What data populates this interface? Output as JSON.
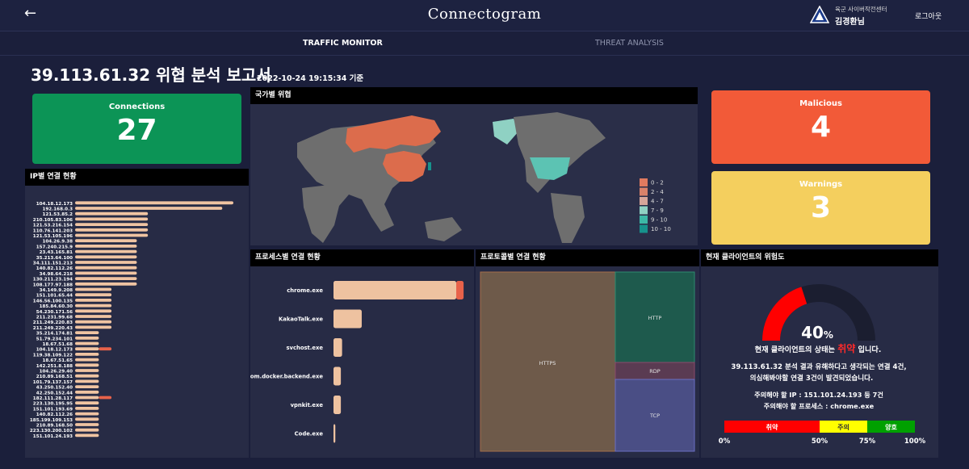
{
  "header": {
    "back_icon": "arrow-left-icon",
    "title": "Connectogram",
    "org": "육군 사이버작전센터",
    "user": "김경환님",
    "logout": "로그아웃"
  },
  "tabs": [
    {
      "label": "TRAFFIC MONITOR",
      "active": true
    },
    {
      "label": "THREAT ANALYSIS",
      "active": false
    }
  ],
  "report": {
    "title": "39.113.61.32 위협 분석 보고서",
    "timestamp": "2022-10-24 19:15:34 기준"
  },
  "connections": {
    "label": "Connections",
    "value": "27",
    "color": "#0c9456"
  },
  "malicious": {
    "label": "Malicious",
    "value": "4",
    "color": "#f25a38"
  },
  "warnings": {
    "label": "Warnings",
    "value": "3",
    "color": "#f4cf5e"
  },
  "ip_panel": {
    "title": "IP별 연결 현황",
    "rows": [
      {
        "ip": "104.18.12.173",
        "v": 100,
        "mal": 0
      },
      {
        "ip": "192.168.0.3",
        "v": 93,
        "mal": 0
      },
      {
        "ip": "121.53.85.2",
        "v": 46,
        "mal": 0
      },
      {
        "ip": "210.105.83.106",
        "v": 46,
        "mal": 0
      },
      {
        "ip": "121.53.216.154",
        "v": 46,
        "mal": 0
      },
      {
        "ip": "110.76.141.203",
        "v": 46,
        "mal": 0
      },
      {
        "ip": "121.53.105.196",
        "v": 46,
        "mal": 0
      },
      {
        "ip": "104.26.9.38",
        "v": 39,
        "mal": 0
      },
      {
        "ip": "157.240.215.9",
        "v": 39,
        "mal": 0
      },
      {
        "ip": "23.43.165.81",
        "v": 39,
        "mal": 0
      },
      {
        "ip": "35.213.64.100",
        "v": 39,
        "mal": 0
      },
      {
        "ip": "34.111.151.213",
        "v": 39,
        "mal": 0
      },
      {
        "ip": "140.82.112.26",
        "v": 39,
        "mal": 0
      },
      {
        "ip": "34.98.64.218",
        "v": 39,
        "mal": 0
      },
      {
        "ip": "130.211.23.194",
        "v": 39,
        "mal": 0
      },
      {
        "ip": "108.177.97.188",
        "v": 39,
        "mal": 0
      },
      {
        "ip": "34.149.9.208",
        "v": 23,
        "mal": 0
      },
      {
        "ip": "151.101.65.44",
        "v": 23,
        "mal": 0
      },
      {
        "ip": "146.56.100.135",
        "v": 23,
        "mal": 0
      },
      {
        "ip": "185.84.60.30",
        "v": 23,
        "mal": 0
      },
      {
        "ip": "54.230.171.56",
        "v": 23,
        "mal": 0
      },
      {
        "ip": "211.231.99.68",
        "v": 23,
        "mal": 0
      },
      {
        "ip": "211.249.220.83",
        "v": 23,
        "mal": 0
      },
      {
        "ip": "211.249.220.43",
        "v": 23,
        "mal": 0
      },
      {
        "ip": "35.214.174.81",
        "v": 15,
        "mal": 0
      },
      {
        "ip": "51.79.234.101",
        "v": 15,
        "mal": 0
      },
      {
        "ip": "18.67.51.68",
        "v": 15,
        "mal": 0
      },
      {
        "ip": "104.18.12.173",
        "v": 15,
        "mal": 8
      },
      {
        "ip": "119.38.109.122",
        "v": 15,
        "mal": 0
      },
      {
        "ip": "18.67.51.65",
        "v": 15,
        "mal": 0
      },
      {
        "ip": "142.251.8.188",
        "v": 15,
        "mal": 0
      },
      {
        "ip": "104.26.29.40",
        "v": 15,
        "mal": 0
      },
      {
        "ip": "210.89.168.51",
        "v": 15,
        "mal": 0
      },
      {
        "ip": "101.79.137.157",
        "v": 15,
        "mal": 0
      },
      {
        "ip": "43.250.152.40",
        "v": 15,
        "mal": 0
      },
      {
        "ip": "42.250.152.44",
        "v": 15,
        "mal": 0
      },
      {
        "ip": "182.111.28.117",
        "v": 15,
        "mal": 8
      },
      {
        "ip": "223.130.195.95",
        "v": 15,
        "mal": 0
      },
      {
        "ip": "151.101.193.69",
        "v": 15,
        "mal": 0
      },
      {
        "ip": "140.82.112.26",
        "v": 15,
        "mal": 0
      },
      {
        "ip": "185.199.109.153",
        "v": 15,
        "mal": 0
      },
      {
        "ip": "210.89.168.50",
        "v": 15,
        "mal": 0
      },
      {
        "ip": "223.130.200.102",
        "v": 15,
        "mal": 0
      },
      {
        "ip": "151.101.24.193",
        "v": 15,
        "mal": 0
      }
    ]
  },
  "map_panel": {
    "title": "국가별 위협",
    "legend": [
      {
        "label": "0 - 2",
        "color": "#e07a5f"
      },
      {
        "label": "2 - 4",
        "color": "#d9826a"
      },
      {
        "label": "4 - 7",
        "color": "#d7a69a"
      },
      {
        "label": "7 - 9",
        "color": "#8fd1c3"
      },
      {
        "label": "9 - 10",
        "color": "#3cb8a6"
      },
      {
        "label": "10 - 10",
        "color": "#17928c"
      }
    ]
  },
  "process_panel": {
    "title": "프로세스별 연결 현황",
    "rows": [
      {
        "name": "chrome.exe",
        "v": 100,
        "mal": 6
      },
      {
        "name": "KakaoTalk.exe",
        "v": 23,
        "mal": 0
      },
      {
        "name": "svchost.exe",
        "v": 7,
        "mal": 0
      },
      {
        "name": "com.docker.backend.exe",
        "v": 6,
        "mal": 0
      },
      {
        "name": "vpnkit.exe",
        "v": 6,
        "mal": 0
      },
      {
        "name": "Code.exe",
        "v": 1.5,
        "mal": 0
      }
    ]
  },
  "protocol_panel": {
    "title": "프로토콜별 연결 현황",
    "cells": [
      {
        "label": "HTTPS",
        "color": "#6e5a4a",
        "border": "#a46d4a"
      },
      {
        "label": "HTTP",
        "color": "#1e5a4d",
        "border": "#2f8b6e"
      },
      {
        "label": "RDP",
        "color": "#5a3b52",
        "border": "#8b4a6b"
      },
      {
        "label": "TCP",
        "color": "#4a4e85",
        "border": "#6a6fc2"
      }
    ]
  },
  "risk_panel": {
    "title": "현재 클라이언트의 위험도",
    "gauge_value": 40,
    "gauge_text": "40",
    "gauge_unit": "%",
    "status_prefix": "현재 클라이언트의 상태는 ",
    "status_word": "취약",
    "status_suffix": " 입니다.",
    "line1": "39.113.61.32 분석 결과 유해하다고 생각되는 연결 4건,",
    "line2": "의심해봐야할 연결 3건이 발견되었습니다.",
    "ip_line": "주의해야 할 IP : 151.101.24.193 등 7건",
    "process_line": "주의해야 할 프로세스 : chrome.exe",
    "scale": [
      {
        "label": "취약",
        "color": "#ff0000"
      },
      {
        "label": "주의",
        "color": "#ffff00"
      },
      {
        "label": "양호",
        "color": "#00a000"
      }
    ],
    "ticks": [
      "0%",
      "50%",
      "75%",
      "100%"
    ]
  }
}
